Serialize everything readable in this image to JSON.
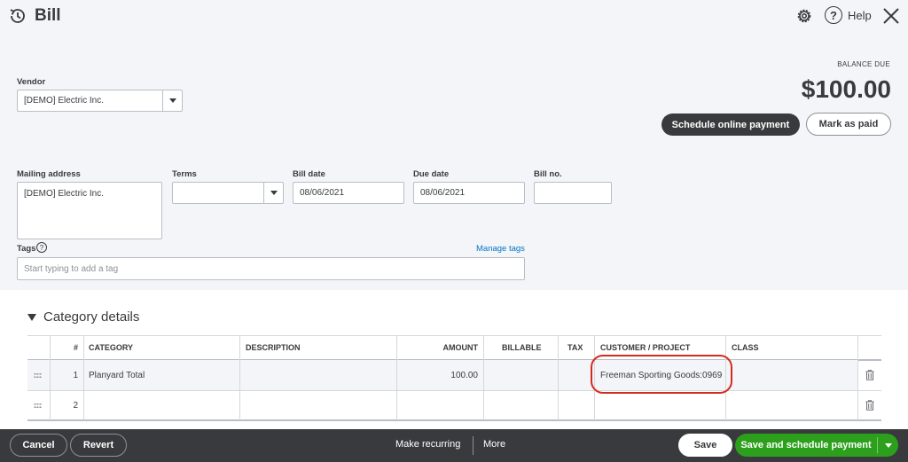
{
  "header": {
    "title": "Bill",
    "help": "Help",
    "help_glyph": "?"
  },
  "form": {
    "vendor_label": "Vendor",
    "vendor_value": "[DEMO] Electric Inc.",
    "mailing_label": "Mailing address",
    "mailing_value": "[DEMO] Electric Inc.",
    "terms_label": "Terms",
    "terms_value": "",
    "bill_date_label": "Bill date",
    "bill_date_value": "08/06/2021",
    "due_date_label": "Due date",
    "due_date_value": "08/06/2021",
    "bill_no_label": "Bill no.",
    "bill_no_value": "",
    "tags_label": "Tags",
    "tags_placeholder": "Start typing to add a tag",
    "manage_tags": "Manage tags"
  },
  "balance": {
    "label": "BALANCE DUE",
    "amount": "$100.00",
    "schedule_btn": "Schedule online payment",
    "mark_paid_btn": "Mark as paid"
  },
  "category": {
    "title": "Category details",
    "columns": [
      "#",
      "CATEGORY",
      "DESCRIPTION",
      "AMOUNT",
      "BILLABLE",
      "TAX",
      "CUSTOMER / PROJECT",
      "CLASS"
    ],
    "rows": [
      {
        "num": "1",
        "category": "Planyard Total",
        "description": "",
        "amount": "100.00",
        "customer": "Freeman Sporting Goods:0969",
        "class": ""
      },
      {
        "num": "2",
        "category": "",
        "description": "",
        "amount": "",
        "customer": "",
        "class": ""
      }
    ]
  },
  "footer": {
    "cancel": "Cancel",
    "revert": "Revert",
    "make_recurring": "Make recurring",
    "more": "More",
    "save": "Save",
    "save_schedule": "Save and schedule payment"
  },
  "colors": {
    "primary_green": "#2ca01c",
    "dark": "#393a3d",
    "link": "#0077c5",
    "highlight_red": "#d52b1e"
  }
}
